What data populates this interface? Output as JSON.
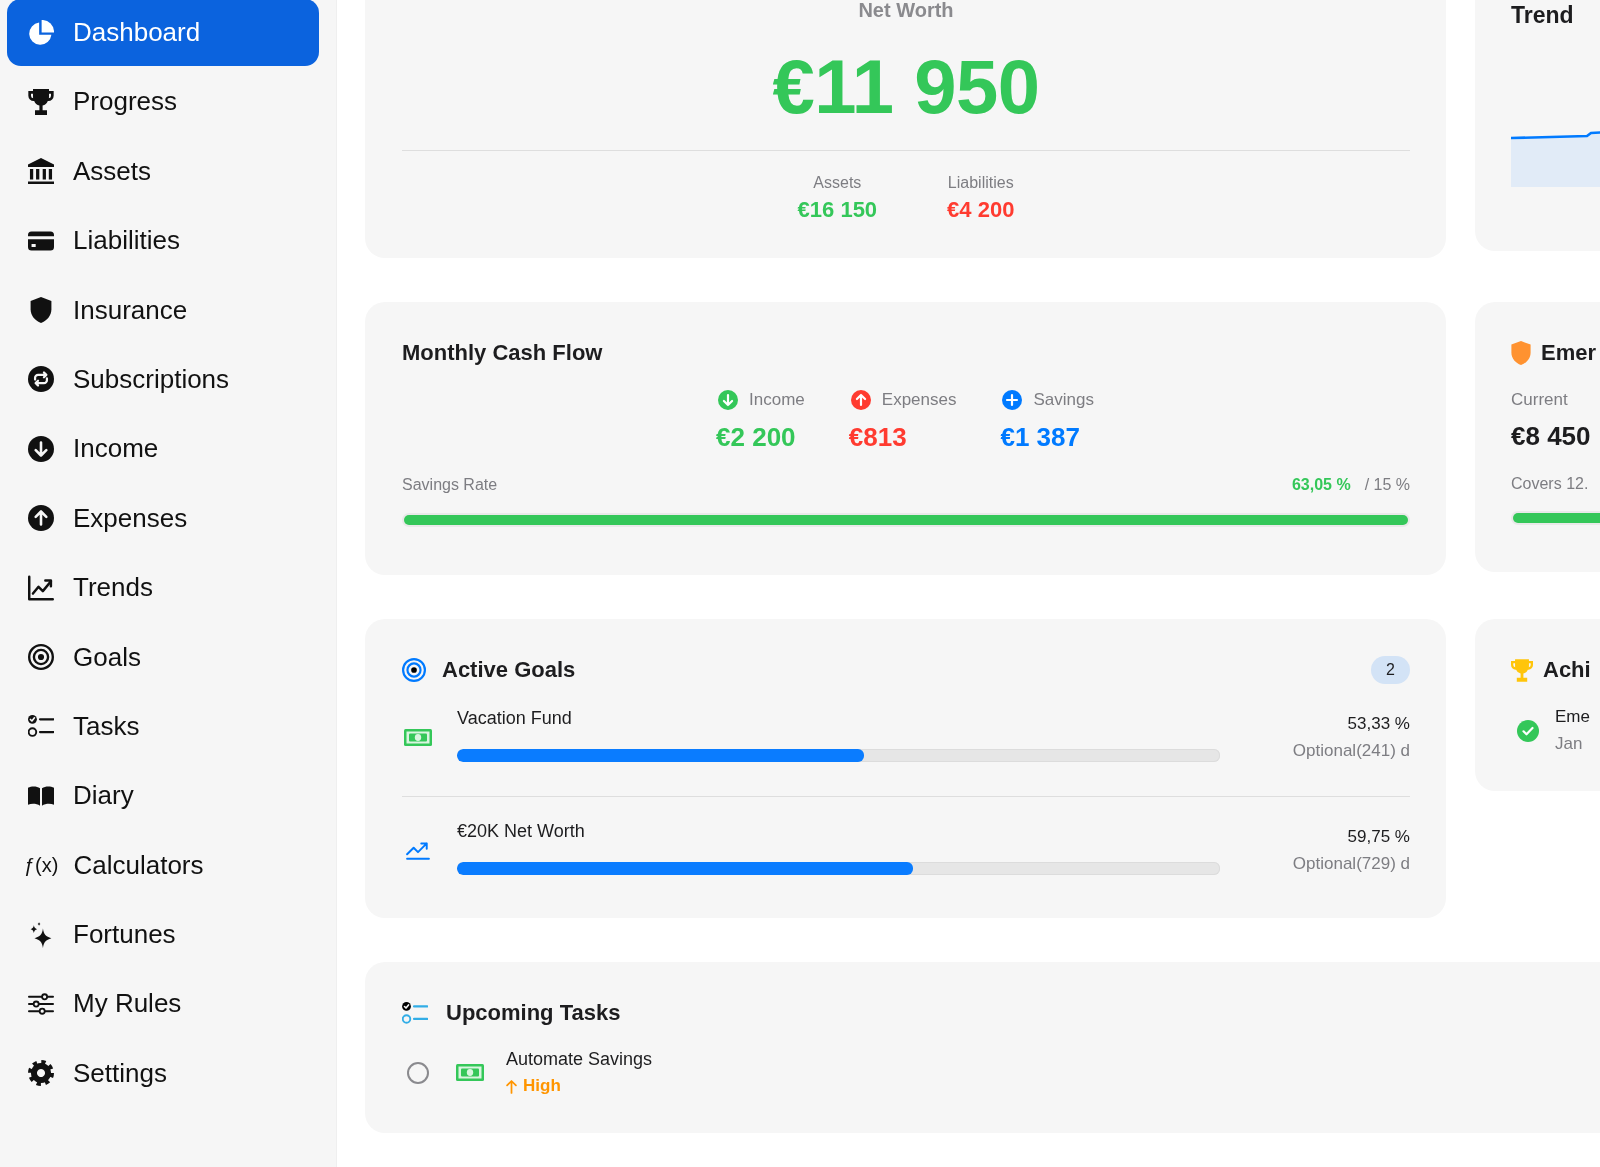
{
  "sidebar": {
    "items": [
      {
        "label": "Dashboard",
        "selected": true
      },
      {
        "label": "Progress",
        "selected": false
      },
      {
        "label": "Assets",
        "selected": false
      },
      {
        "label": "Liabilities",
        "selected": false
      },
      {
        "label": "Insurance",
        "selected": false
      },
      {
        "label": "Subscriptions",
        "selected": false
      },
      {
        "label": "Income",
        "selected": false
      },
      {
        "label": "Expenses",
        "selected": false
      },
      {
        "label": "Trends",
        "selected": false
      },
      {
        "label": "Goals",
        "selected": false
      },
      {
        "label": "Tasks",
        "selected": false
      },
      {
        "label": "Diary",
        "selected": false
      },
      {
        "label": "Calculators",
        "selected": false,
        "glyph": "ƒ(x)"
      },
      {
        "label": "Fortunes",
        "selected": false
      },
      {
        "label": "My Rules",
        "selected": false
      },
      {
        "label": "Settings",
        "selected": false
      }
    ]
  },
  "net_worth": {
    "title": "Net Worth",
    "value": "€11 950",
    "breakdown": [
      {
        "kind": "asset",
        "label": "Assets",
        "value": "€16 150"
      },
      {
        "kind": "liability",
        "label": "Liabilities",
        "value": "€4 200"
      }
    ]
  },
  "trend": {
    "title": "Trend"
  },
  "cash_flow": {
    "title": "Monthly Cash Flow",
    "stats": [
      {
        "kind": "income",
        "label": "Income",
        "value": "€2 200"
      },
      {
        "kind": "expenses",
        "label": "Expenses",
        "value": "€813"
      },
      {
        "kind": "savings",
        "label": "Savings",
        "value": "€1 387"
      }
    ],
    "savings_rate": {
      "label": "Savings Rate",
      "value": "63,05 %",
      "target": "/ 15 %",
      "level": 1
    }
  },
  "emergency": {
    "title": "Emer",
    "current_label": "Current",
    "current_value": "€8 450",
    "coverage": "Covers 12.",
    "level": 1
  },
  "goals": {
    "title": "Active Goals",
    "count": "2",
    "items": [
      {
        "kind": "money",
        "name": "Vacation Fund",
        "level": 0.5333,
        "percent": "53,33 %",
        "deadline": "Optional(241) d"
      },
      {
        "kind": "chart",
        "name": "€20K Net Worth",
        "level": 0.5975,
        "percent": "59,75 %",
        "deadline": "Optional(729) d"
      }
    ]
  },
  "achievements": {
    "title": "Achi",
    "items": [
      {
        "title": "Eme",
        "date": "Jan"
      }
    ]
  },
  "tasks": {
    "title": "Upcoming Tasks",
    "items": [
      {
        "kind": "money",
        "checked": false,
        "title": "Automate Savings",
        "priority": "High"
      }
    ]
  }
}
